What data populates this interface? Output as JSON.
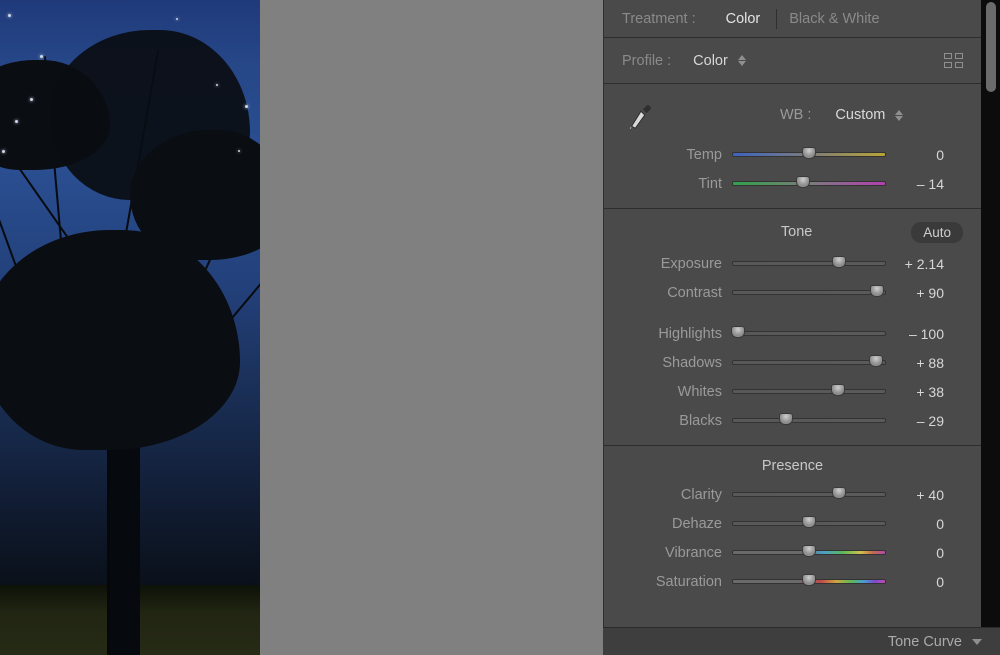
{
  "treatment": {
    "label": "Treatment :",
    "options": {
      "color": "Color",
      "bw": "Black & White"
    },
    "selected": "color"
  },
  "profile": {
    "label": "Profile :",
    "value": "Color"
  },
  "wb": {
    "label": "WB :",
    "preset": "Custom",
    "temp": {
      "label": "Temp",
      "value": 0,
      "pos": 50,
      "track": "track-temp"
    },
    "tint": {
      "label": "Tint",
      "value": -14,
      "pos": 46,
      "track": "track-tint",
      "prefix": "– "
    }
  },
  "tone": {
    "title": "Tone",
    "auto": "Auto",
    "sliders": [
      {
        "label": "Exposure",
        "value": "+ 2.14",
        "pos": 70,
        "track": "track-gray"
      },
      {
        "label": "Contrast",
        "value": "+ 90",
        "pos": 95,
        "track": "track-gray"
      },
      {
        "gap": true
      },
      {
        "label": "Highlights",
        "value": "– 100",
        "pos": 3,
        "track": "track-gray"
      },
      {
        "label": "Shadows",
        "value": "+ 88",
        "pos": 94,
        "track": "track-gray"
      },
      {
        "label": "Whites",
        "value": "+ 38",
        "pos": 69,
        "track": "track-gray"
      },
      {
        "label": "Blacks",
        "value": "– 29",
        "pos": 35,
        "track": "track-gray"
      }
    ]
  },
  "presence": {
    "title": "Presence",
    "sliders": [
      {
        "label": "Clarity",
        "value": "+ 40",
        "pos": 70,
        "track": "track-gray"
      },
      {
        "label": "Dehaze",
        "value": "0",
        "pos": 50,
        "track": "track-gray"
      },
      {
        "label": "Vibrance",
        "value": "0",
        "pos": 50,
        "track": "track-vib"
      },
      {
        "label": "Saturation",
        "value": "0",
        "pos": 50,
        "track": "track-sat"
      }
    ]
  },
  "collapsed_footer": "Tone Curve"
}
